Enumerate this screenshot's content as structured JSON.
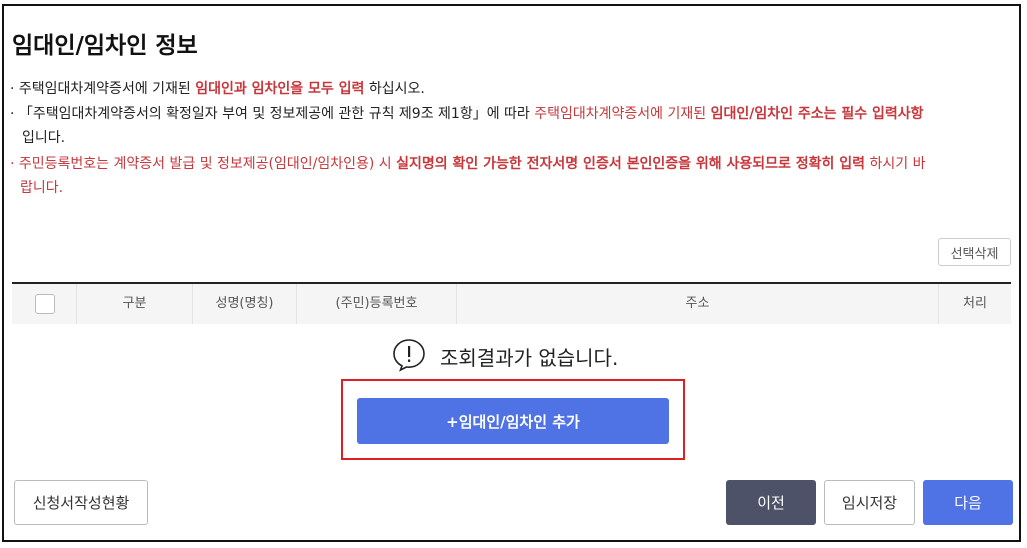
{
  "section": {
    "title": "임대인/임차인 정보"
  },
  "notices": {
    "line1": {
      "prefix": "· 주택임대차계약증서에 기재된 ",
      "emph": "임대인과 임차인을 모두 입력",
      "suffix": " 하십시오."
    },
    "line2": {
      "prefix": "· 「주택임대차계약증서의 확정일자 부여 및 정보제공에 관한 규칙 제9조 제1항」에 따라 ",
      "red": "주택임대차계약증서에 기재된 ",
      "emph": "임대인/임차인 주소는 필수 입력사항",
      "cont": "입니다."
    },
    "line3": {
      "red1": "· 주민등록번호는 계약증서 발급 및 정보제공(임대인/임차인용) 시 ",
      "emph": "실지명의 확인 가능한 전자서명 인증서 본인인증을 위해 사용되므로 정확히 입력",
      "red2": " 하시기 바",
      "cont": "랍니다."
    }
  },
  "table": {
    "delete_selected": "선택삭제",
    "columns": {
      "type": "구분",
      "name": "성명(명칭)",
      "id_number": "(주민)등록번호",
      "address": "주소",
      "action": "처리"
    },
    "empty_message": "조회결과가 없습니다."
  },
  "actions": {
    "add_party": "+임대인/임차인 추가",
    "application_status": "신청서작성현황",
    "prev": "이전",
    "temp_save": "임시저장",
    "next": "다음"
  },
  "colors": {
    "accent": "#4f72e5",
    "dark_button": "#4d5268",
    "emphasis_red": "#c8373c",
    "highlight_box": "#e02020"
  }
}
